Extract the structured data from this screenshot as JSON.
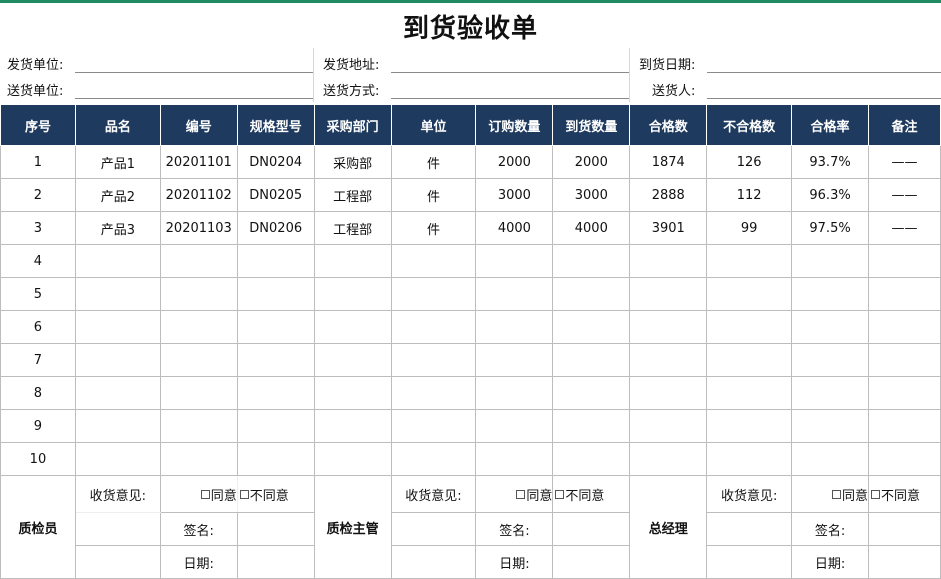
{
  "title": "到货验收单",
  "info": {
    "sender_unit": "发货单位:",
    "sender_address": "发货地址:",
    "arrival_date": "到货日期:",
    "delivery_unit": "送货单位:",
    "delivery_method": "送货方式:",
    "deliverer": "送货人:"
  },
  "headers": [
    "序号",
    "品名",
    "编号",
    "规格型号",
    "采购部门",
    "单位",
    "订购数量",
    "到货数量",
    "合格数",
    "不合格数",
    "合格率",
    "备注"
  ],
  "rows": [
    [
      "1",
      "产品1",
      "20201101",
      "DN0204",
      "采购部",
      "件",
      "2000",
      "2000",
      "1874",
      "126",
      "93.7%",
      "——"
    ],
    [
      "2",
      "产品2",
      "20201102",
      "DN0205",
      "工程部",
      "件",
      "3000",
      "3000",
      "2888",
      "112",
      "96.3%",
      "——"
    ],
    [
      "3",
      "产品3",
      "20201103",
      "DN0206",
      "工程部",
      "件",
      "4000",
      "4000",
      "3901",
      "99",
      "97.5%",
      "——"
    ],
    [
      "4",
      "",
      "",
      "",
      "",
      "",
      "",
      "",
      "",
      "",
      "",
      ""
    ],
    [
      "5",
      "",
      "",
      "",
      "",
      "",
      "",
      "",
      "",
      "",
      "",
      ""
    ],
    [
      "6",
      "",
      "",
      "",
      "",
      "",
      "",
      "",
      "",
      "",
      "",
      ""
    ],
    [
      "7",
      "",
      "",
      "",
      "",
      "",
      "",
      "",
      "",
      "",
      "",
      ""
    ],
    [
      "8",
      "",
      "",
      "",
      "",
      "",
      "",
      "",
      "",
      "",
      "",
      ""
    ],
    [
      "9",
      "",
      "",
      "",
      "",
      "",
      "",
      "",
      "",
      "",
      "",
      ""
    ],
    [
      "10",
      "",
      "",
      "",
      "",
      "",
      "",
      "",
      "",
      "",
      "",
      ""
    ]
  ],
  "footer": {
    "opinion_label": "收货意见:",
    "agree": "同意",
    "disagree": "不同意",
    "sign_label": "签名:",
    "date_label": "日期:",
    "roles": [
      "质检员",
      "质检主管",
      "总经理"
    ]
  }
}
